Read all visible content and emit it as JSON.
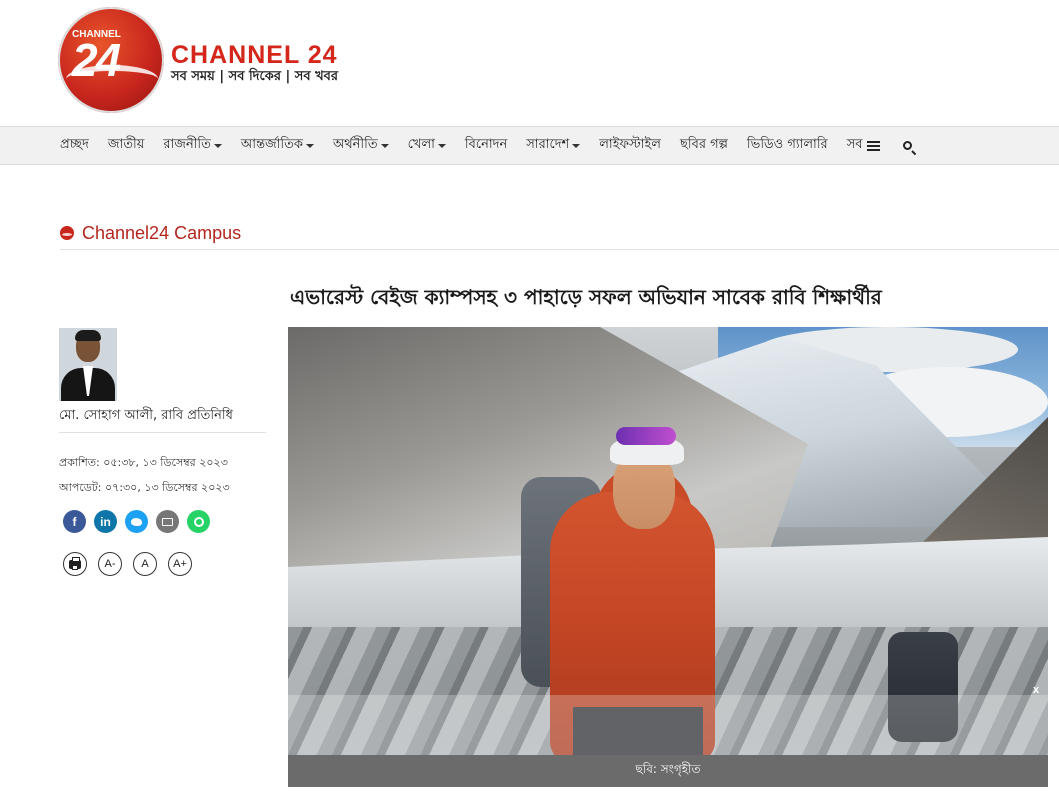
{
  "logo": {
    "circle_number": "24",
    "circle_text": "CHANNEL",
    "name": "CHANNEL 24",
    "tagline": "সব সময় | সব দিকের | সব খবর"
  },
  "nav": {
    "items": [
      {
        "label": "প্রচ্ছদ",
        "dropdown": false
      },
      {
        "label": "জাতীয়",
        "dropdown": false
      },
      {
        "label": "রাজনীতি",
        "dropdown": true
      },
      {
        "label": "আন্তর্জাতিক",
        "dropdown": true
      },
      {
        "label": "অর্থনীতি",
        "dropdown": true
      },
      {
        "label": "খেলা",
        "dropdown": true
      },
      {
        "label": "বিনোদন",
        "dropdown": false
      },
      {
        "label": "সারাদেশ",
        "dropdown": true
      },
      {
        "label": "লাইফস্টাইল",
        "dropdown": false
      },
      {
        "label": "ছবির গল্প",
        "dropdown": false
      },
      {
        "label": "ভিডিও গ্যালারি",
        "dropdown": false
      }
    ],
    "all_label": "সব"
  },
  "section": {
    "label": "Channel24 Campus"
  },
  "article": {
    "headline": "এভারেস্ট বেইজ ক্যাম্পসহ ৩ পাহাড়ে সফল অভিযান সাবেক রাবি শিক্ষার্থীর",
    "author": "মো. সোহাগ আলী, রাবি প্রতিনিধি",
    "published": "প্রকাশিত: ০৫:৩৮, ১৩ ডিসেম্বর ২০২৩",
    "updated": "আপডেট: ০৭:৩০, ১৩ ডিসেম্বর ২০২৩",
    "image_caption": "ছবি: সংগৃহীত",
    "close_label": "x"
  },
  "share": {
    "facebook": "f",
    "linkedin": "in"
  },
  "tools": {
    "font_decrease": "A-",
    "font_reset": "A",
    "font_increase": "A+"
  },
  "colors": {
    "brand_red": "#c8261d",
    "section_red": "#b3261e",
    "facebook": "#3b5998",
    "linkedin": "#0e76a8",
    "twitter": "#1da1f2",
    "email": "#777777",
    "whatsapp": "#25d366"
  },
  "icons": [
    "search-icon",
    "menu-icon",
    "facebook-icon",
    "linkedin-icon",
    "twitter-icon",
    "email-icon",
    "whatsapp-icon",
    "print-icon"
  ]
}
